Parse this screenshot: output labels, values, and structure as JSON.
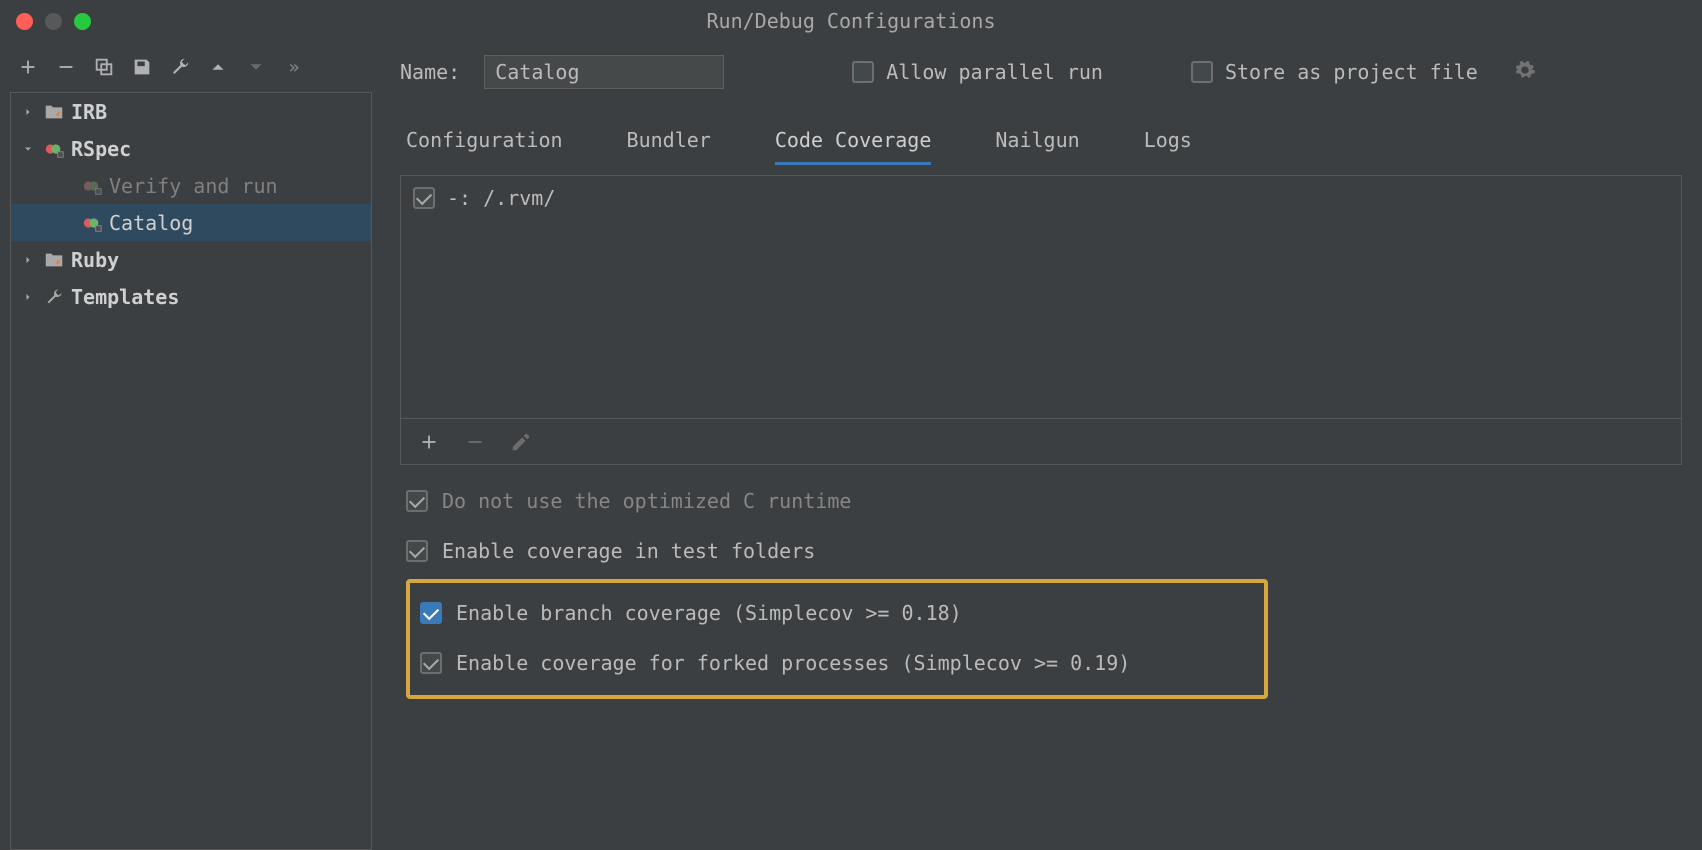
{
  "window": {
    "title": "Run/Debug Configurations"
  },
  "tree": {
    "items": [
      {
        "label": "IRB",
        "expanded": false,
        "depth": 0
      },
      {
        "label": "RSpec",
        "expanded": true,
        "depth": 0,
        "bold": true
      },
      {
        "label": "Verify and run",
        "depth": 1,
        "dim": true
      },
      {
        "label": "Catalog",
        "depth": 1,
        "selected": true
      },
      {
        "label": "Ruby",
        "expanded": false,
        "depth": 0
      },
      {
        "label": "Templates",
        "expanded": false,
        "depth": 0
      }
    ]
  },
  "form": {
    "name_label": "Name:",
    "name_value": "Catalog",
    "allow_parallel": {
      "label": "Allow parallel run",
      "checked": false
    },
    "store_as_file": {
      "label": "Store as project file",
      "checked": false
    }
  },
  "tabs": [
    {
      "label": "Configuration",
      "active": false
    },
    {
      "label": "Bundler",
      "active": false
    },
    {
      "label": "Code Coverage",
      "active": true
    },
    {
      "label": "Nailgun",
      "active": false
    },
    {
      "label": "Logs",
      "active": false
    }
  ],
  "coverage": {
    "list_item": {
      "label": "-: /.rvm/",
      "checked": true
    },
    "options": [
      {
        "label": "Do not use the optimized C runtime",
        "checked": true,
        "dim": true
      },
      {
        "label": "Enable coverage in test folders",
        "checked": true
      },
      {
        "label": "Enable branch coverage (Simplecov >= 0.18)",
        "checked": true,
        "emphasis": true
      },
      {
        "label": "Enable coverage for forked processes (Simplecov >= 0.19)",
        "checked": true
      }
    ]
  }
}
